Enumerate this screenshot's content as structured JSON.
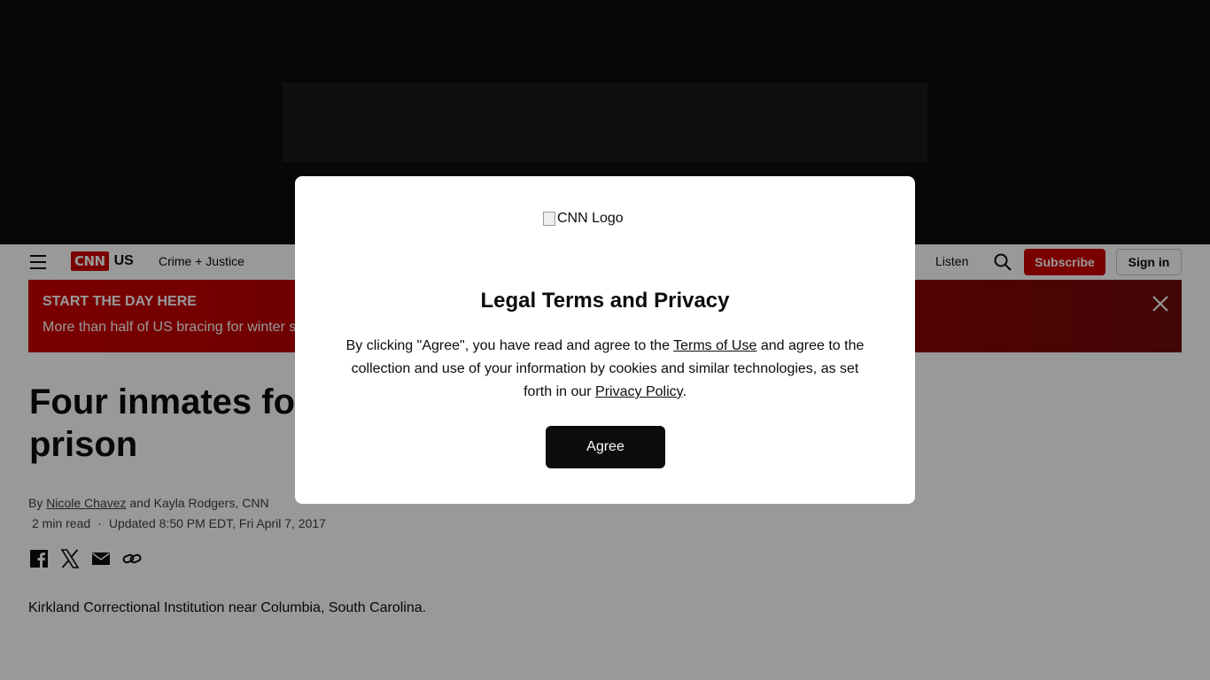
{
  "header": {
    "section": "US",
    "nav_crime": "Crime + Justice",
    "listen": "Listen",
    "subscribe": "Subscribe",
    "signin": "Sign in"
  },
  "banner": {
    "kicker": "START THE DAY HERE",
    "text": "More than half of US bracing for winter s"
  },
  "article": {
    "headline_line1": "Four inmates fo",
    "headline_line2": "prison",
    "byline_by": "By",
    "author1": "Nicole Chavez",
    "byline_rest": "and Kayla Rodgers, CNN",
    "read_time": "2 min read",
    "updated": "Updated 8:50 PM EDT, Fri April 7, 2017",
    "image_alt": "Kirkland Correctional Institution near Columbia, South Carolina."
  },
  "modal": {
    "logo_alt": "CNN Logo",
    "title": "Legal Terms and Privacy",
    "body_part1": "By clicking \"Agree\", you have read and agree to the",
    "terms_link": "Terms of Use",
    "body_part2": "and agree to the collection and use of your information by cookies and similar technologies, as set forth in our",
    "privacy_link": "Privacy Policy",
    "body_end": ".",
    "agree_button": "Agree"
  },
  "colors": {
    "brand_red": "#cc0000",
    "overlay": "rgba(0,0,0,0.4)"
  },
  "icons": [
    "hamburger-icon",
    "search-icon",
    "close-icon",
    "facebook-icon",
    "x-icon",
    "email-icon",
    "link-icon"
  ]
}
